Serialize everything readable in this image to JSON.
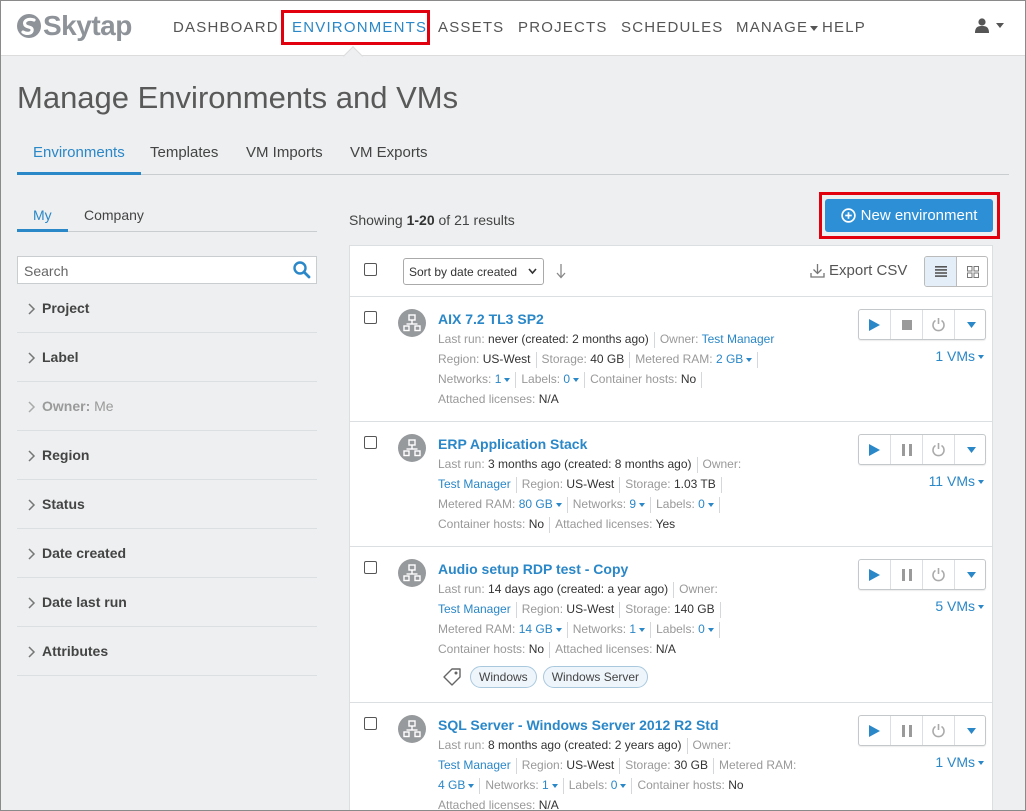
{
  "brand": {
    "name": "Skytap"
  },
  "nav": {
    "items": [
      {
        "label": "DASHBOARD",
        "active": false
      },
      {
        "label": "ENVIRONMENTS",
        "active": true
      },
      {
        "label": "ASSETS",
        "active": false
      },
      {
        "label": "PROJECTS",
        "active": false
      },
      {
        "label": "SCHEDULES",
        "active": false
      },
      {
        "label": "MANAGE",
        "active": false,
        "dropdown": true
      },
      {
        "label": "HELP",
        "active": false
      }
    ],
    "user_icon": "user-icon"
  },
  "page": {
    "title": "Manage Environments and VMs"
  },
  "tabs": [
    {
      "label": "Environments",
      "active": true
    },
    {
      "label": "Templates",
      "active": false
    },
    {
      "label": "VM Imports",
      "active": false
    },
    {
      "label": "VM Exports",
      "active": false
    }
  ],
  "sidebar": {
    "scope_tabs": [
      {
        "label": "My",
        "active": true
      },
      {
        "label": "Company",
        "active": false
      }
    ],
    "search_placeholder": "Search",
    "filters": [
      {
        "label": "Project"
      },
      {
        "label": "Label"
      },
      {
        "label": "Owner:",
        "value": "Me"
      },
      {
        "label": "Region"
      },
      {
        "label": "Status"
      },
      {
        "label": "Date created"
      },
      {
        "label": "Date last run"
      },
      {
        "label": "Attributes"
      }
    ]
  },
  "results": {
    "prefix": "Showing ",
    "range": "1-20",
    "suffix": " of 21 results"
  },
  "actions": {
    "new_environment": "New environment",
    "export_csv": "Export CSV",
    "sort_label": "Sort by date created"
  },
  "labels": {
    "last_run": "Last run:",
    "owner": "Owner:",
    "region": "Region:",
    "storage": "Storage:",
    "metered_ram": "Metered RAM:",
    "networks": "Networks:",
    "labels": "Labels:",
    "container_hosts": "Container hosts:",
    "attached_licenses": "Attached licenses:"
  },
  "environments": [
    {
      "name": "AIX 7.2 TL3 SP2",
      "last_run": "never (created: 2 months ago)",
      "owner": "Test Manager",
      "region": "US-West",
      "storage": "40 GB",
      "metered_ram": "2 GB",
      "networks": "1",
      "labels": "0",
      "container_hosts": "No",
      "attached_licenses": "N/A",
      "vms": "1 VMs",
      "state": "running",
      "tags": []
    },
    {
      "name": "ERP Application Stack",
      "last_run": "3 months ago (created: 8 months ago)",
      "owner": "Test Manager",
      "region": "US-West",
      "storage": "1.03 TB",
      "metered_ram": "80 GB",
      "networks": "9",
      "labels": "0",
      "container_hosts": "No",
      "attached_licenses": "Yes",
      "vms": "11 VMs",
      "state": "suspendable",
      "tags": []
    },
    {
      "name": "Audio setup RDP test - Copy",
      "last_run": "14 days ago (created: a year ago)",
      "owner": "Test Manager",
      "region": "US-West",
      "storage": "140 GB",
      "metered_ram": "14 GB",
      "networks": "1",
      "labels": "0",
      "container_hosts": "No",
      "attached_licenses": "N/A",
      "vms": "5 VMs",
      "state": "suspendable",
      "tags": [
        "Windows",
        "Windows Server"
      ]
    },
    {
      "name": "SQL Server - Windows Server 2012 R2 Std",
      "last_run": "8 months ago (created: 2 years ago)",
      "owner": "Test Manager",
      "region": "US-West",
      "storage": "30 GB",
      "metered_ram": "4 GB",
      "networks": "1",
      "labels": "0",
      "container_hosts": "No",
      "attached_licenses": "N/A",
      "vms": "1 VMs",
      "state": "suspendable",
      "tags": []
    }
  ],
  "colors": {
    "accent": "#2a87c8",
    "primary_button": "#2d8fd5",
    "highlight": "#e2000f"
  }
}
